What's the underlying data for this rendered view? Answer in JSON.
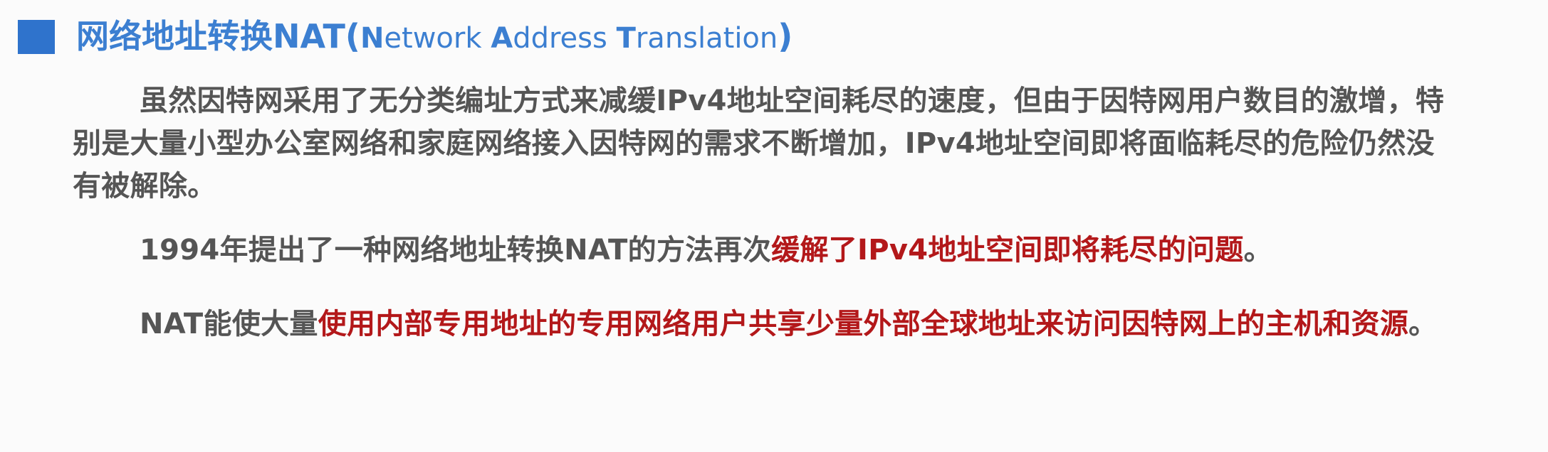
{
  "title": {
    "main": "网络地址转换NAT",
    "open_paren": "(",
    "en_n": "N",
    "en_etwork": "etwork ",
    "en_a": "A",
    "en_ddress": "ddress ",
    "en_t": "T",
    "en_ranslation": "ranslation",
    "close_paren": ")"
  },
  "paragraphs": {
    "p1": "虽然因特网采用了无分类编址方式来减缓IPv4地址空间耗尽的速度，但由于因特网用户数目的激增，特别是大量小型办公室网络和家庭网络接入因特网的需求不断增加，IPv4地址空间即将面临耗尽的危险仍然没有被解除。",
    "p2_normal": "1994年提出了一种网络地址转换NAT的方法再次",
    "p2_highlight": "缓解了IPv4地址空间即将耗尽的问题",
    "p2_end": "。",
    "p3_normal": "NAT能使大量",
    "p3_highlight": "使用内部专用地址的专用网络用户共享少量外部全球地址来访问因特网上的主机和资源",
    "p3_end": "。"
  },
  "colors": {
    "title": "#3c7fd1",
    "title_square": "#2f73cc",
    "body_text": "#555555",
    "highlight": "#b3181a"
  }
}
